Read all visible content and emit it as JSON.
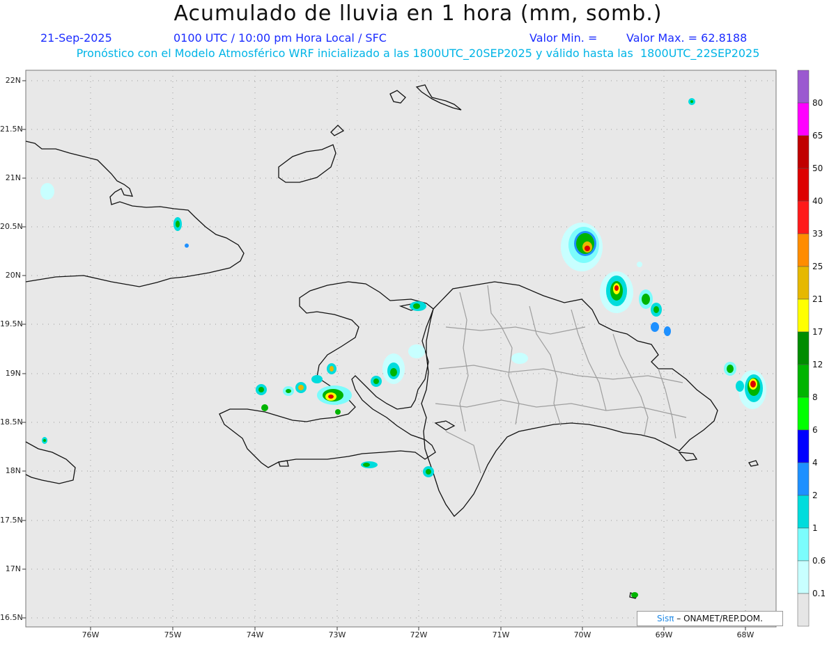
{
  "title": "Acumulado de lluvia en 1 hora (mm, somb.)",
  "line2": {
    "date": "21-Sep-2025",
    "time": "0100 UTC / 10:00 pm Hora Local / SFC",
    "min": "Valor Min. =",
    "max": "Valor Max. = 62.8188"
  },
  "line3": "Pronóstico con el Modelo Atmosférico WRF inicializado a las 1800UTC_20SEP2025 y válido hasta las  1800UTC_22SEP2025",
  "lat_labels": [
    "22N",
    "21.5N",
    "21N",
    "20.5N",
    "20N",
    "19.5N",
    "19N",
    "18.5N",
    "18N",
    "17.5N",
    "17N",
    "16.5N"
  ],
  "lon_labels": [
    "76W",
    "75W",
    "74W",
    "73W",
    "72W",
    "71W",
    "70W",
    "69W",
    "68W"
  ],
  "colorbar": {
    "labels": [
      "80",
      "65",
      "50",
      "40",
      "33",
      "25",
      "21",
      "17",
      "12",
      "8",
      "6",
      "4",
      "2",
      "1",
      "0.6",
      "0.1"
    ],
    "colors": [
      "#9b59d0",
      "#ff00ff",
      "#c00000",
      "#dd0000",
      "#ff1a1a",
      "#ff8c00",
      "#e6b800",
      "#ffff00",
      "#008c00",
      "#00b400",
      "#00ff00",
      "#0000ff",
      "#1e90ff",
      "#00dcdc",
      "#7cfcfc",
      "#c8ffff",
      "#e6e6e6"
    ]
  },
  "credit": {
    "brand": "Sisπ",
    "text": " – ONAMET/REP.DOM."
  }
}
